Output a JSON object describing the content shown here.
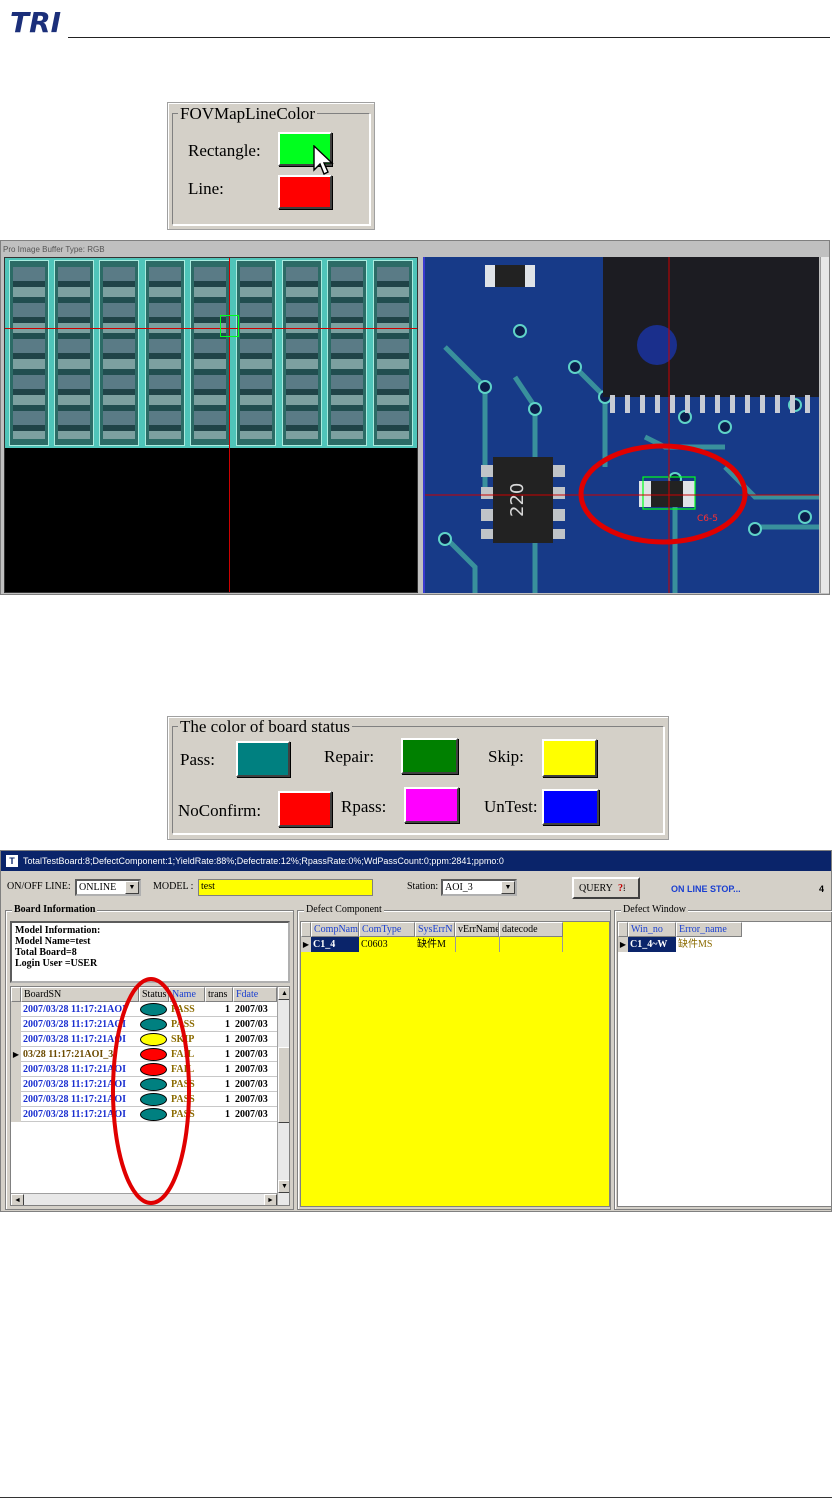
{
  "page": {
    "logo_text": "TRI"
  },
  "fov_map": {
    "title": "FOVMapLineColor",
    "rectangle_label": "Rectangle:",
    "line_label": "Line:",
    "rectangle_color": "#00ff1e",
    "line_color": "#ff0000"
  },
  "image_viewer": {
    "title": "Pro Image Buffer Type: RGB",
    "component_label": "C6-5",
    "pad_text": "220"
  },
  "board_status": {
    "title": "The color of board status",
    "items": [
      {
        "label": "Pass:",
        "color": "#008080"
      },
      {
        "label": "Repair:",
        "color": "#008000"
      },
      {
        "label": "Skip:",
        "color": "#ffff00"
      },
      {
        "label": "NoConfirm:",
        "color": "#ff0000"
      },
      {
        "label": "Rpass:",
        "color": "#ff00ff"
      },
      {
        "label": "UnTest:",
        "color": "#0000ff"
      }
    ]
  },
  "app": {
    "title": "TotalTestBoard:8;DefectComponent:1;YieldRate:88%;Defectrate:12%;RpassRate:0%;WdPassCount:0;ppm:2841;ppmo:0",
    "online_label": "ON/OFF LINE:",
    "online_value": "ONLINE",
    "model_label": "MODEL :",
    "model_value": "test",
    "station_label": "Station:",
    "station_value": "AOI_3",
    "query_label": "QUERY",
    "status_text": "ON LINE STOP...",
    "count": "4",
    "board_info": {
      "title": "Board Information",
      "lines": [
        "Model Information:",
        "Model Name=test",
        "Total Board=8",
        "Login User =USER"
      ],
      "columns": [
        "BoardSN",
        "Status",
        "Name",
        "trans",
        "Fdate"
      ],
      "rows": [
        {
          "sn": "2007/03/28 11:17:21AOI",
          "status": "pass",
          "name": "PASS",
          "trans": "1",
          "fdate": "2007/03"
        },
        {
          "sn": "2007/03/28 11:17:21AOI",
          "status": "pass",
          "name": "PASS",
          "trans": "1",
          "fdate": "2007/03"
        },
        {
          "sn": "2007/03/28 11:17:21AOI",
          "status": "skip",
          "name": "SKIP",
          "trans": "1",
          "fdate": "2007/03"
        },
        {
          "sn": "03/28 11:17:21AOI_3",
          "status": "fail",
          "name": "FAIL",
          "trans": "1",
          "fdate": "2007/03"
        },
        {
          "sn": "2007/03/28 11:17:21AOI",
          "status": "fail",
          "name": "FAIL",
          "trans": "1",
          "fdate": "2007/03"
        },
        {
          "sn": "2007/03/28 11:17:21AOI",
          "status": "pass",
          "name": "PASS",
          "trans": "1",
          "fdate": "2007/03"
        },
        {
          "sn": "2007/03/28 11:17:21AOI",
          "status": "pass",
          "name": "PASS",
          "trans": "1",
          "fdate": "2007/03"
        },
        {
          "sn": "2007/03/28 11:17:21AOI",
          "status": "pass",
          "name": "PASS",
          "trans": "1",
          "fdate": "2007/03"
        }
      ]
    },
    "defect_component": {
      "title": "Defect Component",
      "columns": [
        "CompName",
        "ComType",
        "SysErrN",
        "vErrName",
        "datecode"
      ],
      "rows": [
        {
          "comp": "C1_4",
          "type": "C0603",
          "syserr": "缺件M",
          "verr": "",
          "datecode": ""
        }
      ]
    },
    "defect_window": {
      "title": "Defect Window",
      "columns": [
        "Win_no",
        "Error_name"
      ],
      "rows": [
        {
          "win": "C1_4~W",
          "err": "缺件MS"
        }
      ]
    }
  }
}
